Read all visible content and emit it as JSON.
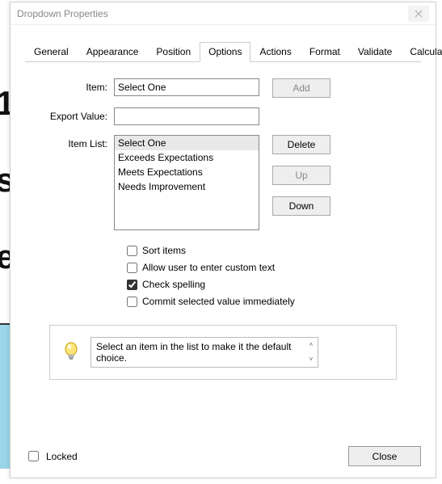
{
  "window": {
    "title": "Dropdown Properties"
  },
  "tabs": [
    {
      "label": "General"
    },
    {
      "label": "Appearance"
    },
    {
      "label": "Position"
    },
    {
      "label": "Options",
      "active": true
    },
    {
      "label": "Actions"
    },
    {
      "label": "Format"
    },
    {
      "label": "Validate"
    },
    {
      "label": "Calculate"
    }
  ],
  "labels": {
    "item": "Item:",
    "export_value": "Export Value:",
    "item_list": "Item List:"
  },
  "fields": {
    "item_value": "Select One",
    "export_value": ""
  },
  "buttons": {
    "add": "Add",
    "delete": "Delete",
    "up": "Up",
    "down": "Down",
    "close": "Close"
  },
  "item_list": [
    "Select One",
    "Exceeds Expectations",
    "Meets Expectations",
    "Needs Improvement"
  ],
  "selected_index": 0,
  "checkboxes": {
    "sort_items": {
      "label": "Sort items",
      "checked": false
    },
    "allow_custom": {
      "label": "Allow user to enter custom text",
      "checked": false
    },
    "check_spell": {
      "label": "Check spelling",
      "checked": true
    },
    "commit": {
      "label": "Commit selected value immediately",
      "checked": false
    }
  },
  "hint": "Select an item in the list to make it the default choice.",
  "locked": {
    "label": "Locked",
    "checked": false
  }
}
